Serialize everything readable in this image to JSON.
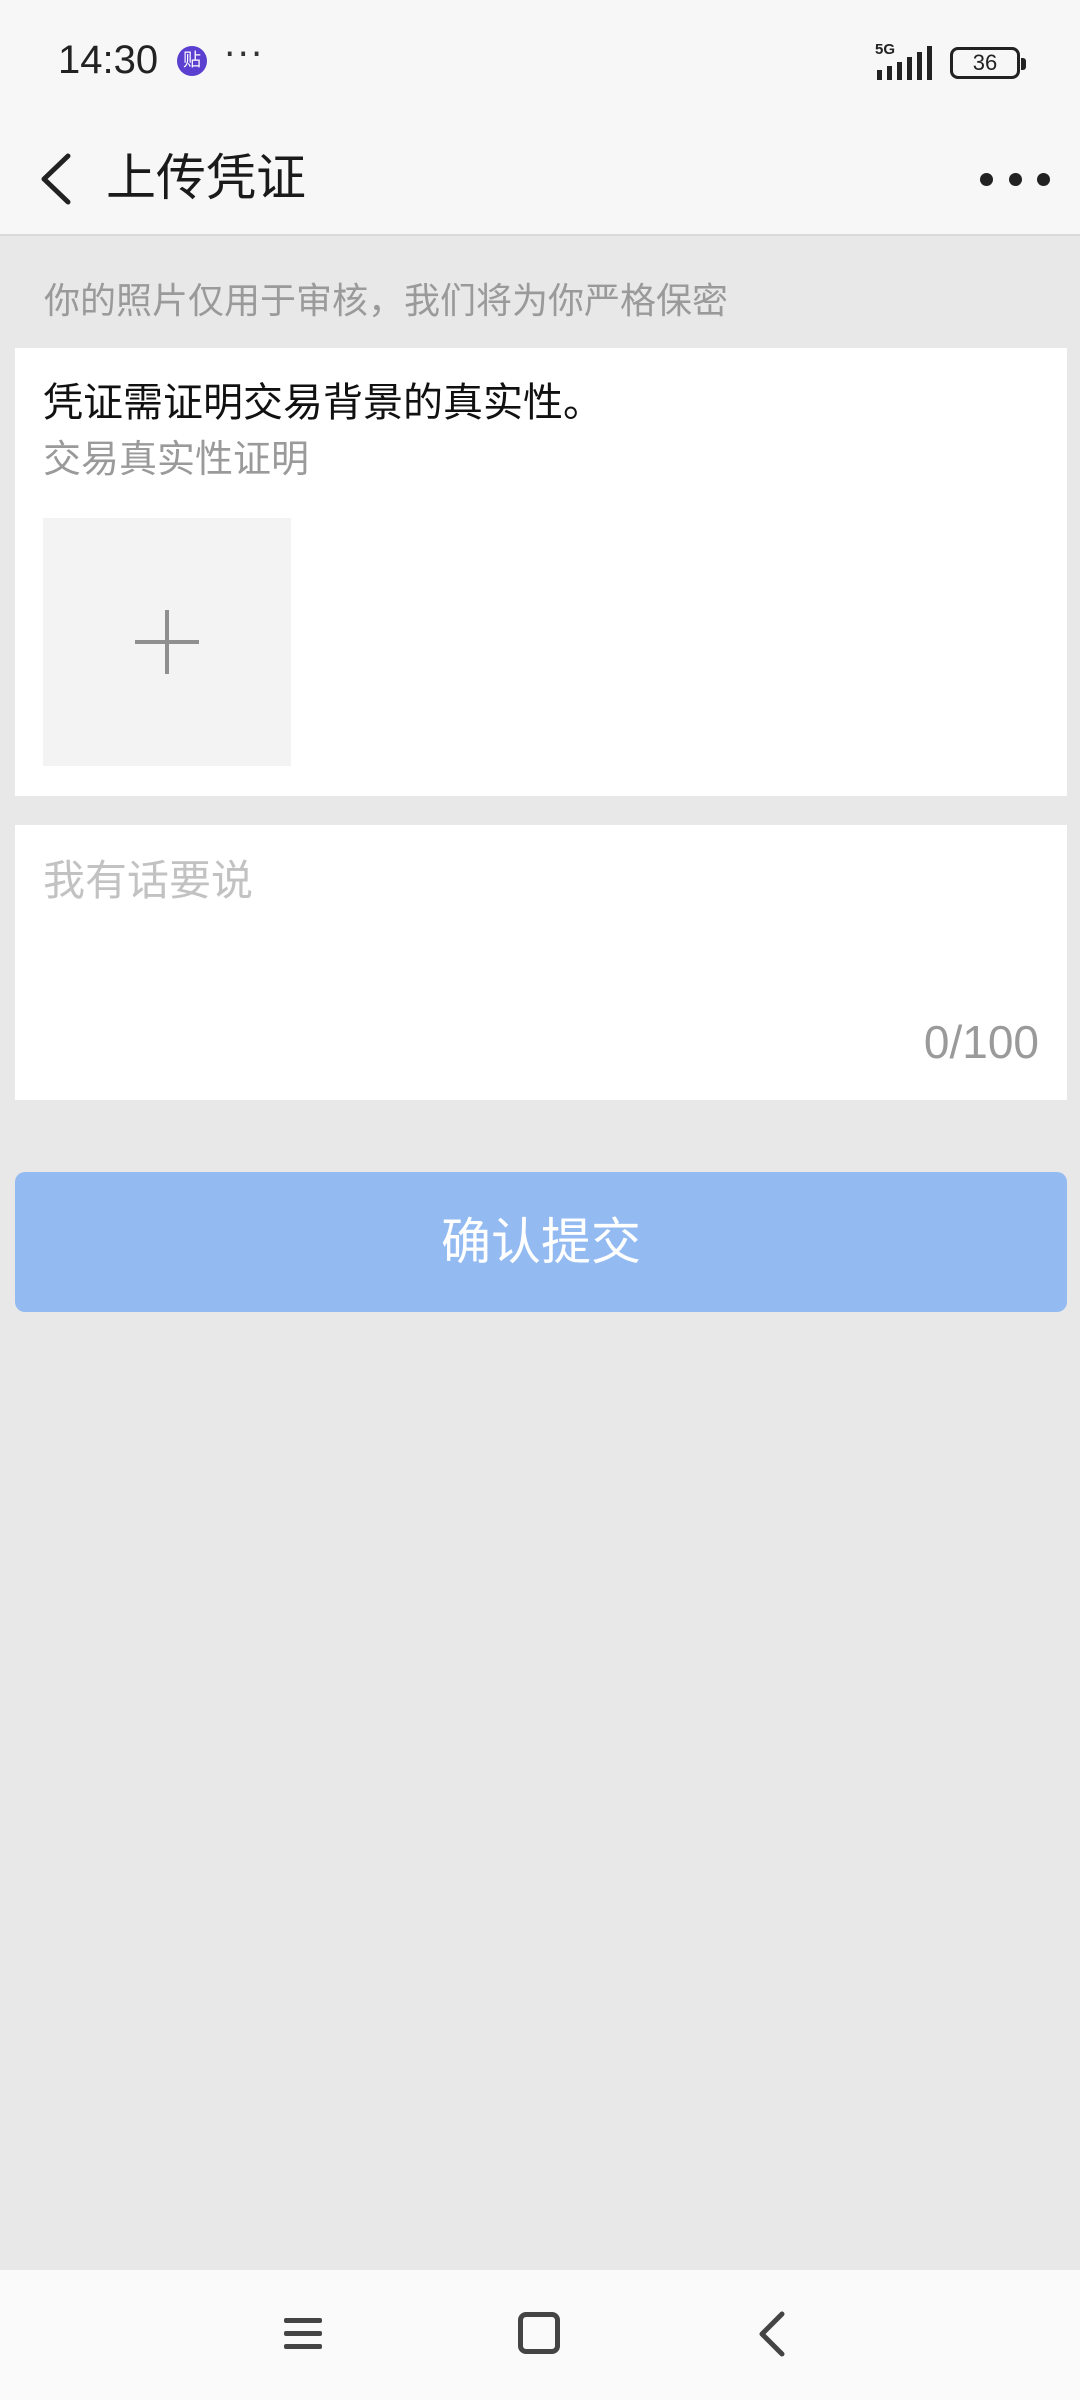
{
  "status_bar": {
    "time": "14:30",
    "app_icon_glyph": "贴",
    "more_glyph": "···",
    "network": "5G",
    "battery": "36"
  },
  "nav": {
    "title": "上传凭证",
    "back_icon": "chevron-left-icon",
    "more_icon": "more-horizontal-icon"
  },
  "hint": "你的照片仅用于审核，我们将为你严格保密",
  "upload": {
    "heading": "凭证需证明交易背景的真实性。",
    "subheading": "交易真实性证明",
    "add_icon": "plus-icon"
  },
  "comment": {
    "placeholder": "我有话要说",
    "value": "",
    "char_count": "0/100"
  },
  "submit": {
    "label": "确认提交"
  },
  "colors": {
    "page_bg": "#e8e8e8",
    "submit_disabled": "#93bbf1",
    "hint_text": "#9a9a9a"
  },
  "system_nav": {
    "menu_icon": "menu-icon",
    "home_icon": "home-square-icon",
    "back_icon": "back-arrow-icon"
  }
}
